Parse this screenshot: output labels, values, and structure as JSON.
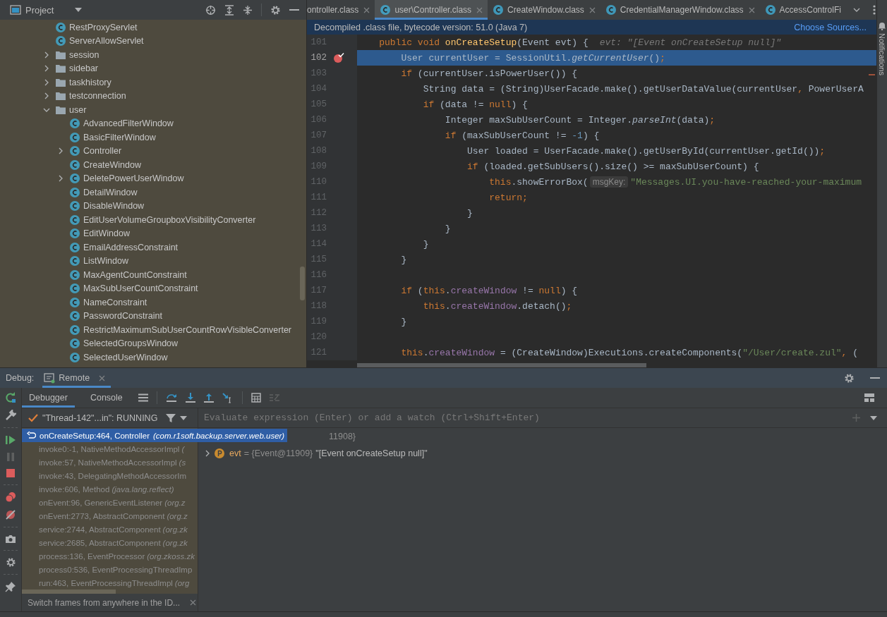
{
  "project": {
    "title": "Project",
    "tree": [
      {
        "label": "RestProxyServlet",
        "kind": "class"
      },
      {
        "label": "ServerAllowServlet",
        "kind": "class"
      },
      {
        "label": "session",
        "kind": "folder",
        "expanded": false
      },
      {
        "label": "sidebar",
        "kind": "folder",
        "expanded": false
      },
      {
        "label": "taskhistory",
        "kind": "folder",
        "expanded": false
      },
      {
        "label": "testconnection",
        "kind": "folder",
        "expanded": false
      },
      {
        "label": "user",
        "kind": "folder",
        "expanded": true,
        "children": [
          {
            "label": "AdvancedFilterWindow",
            "kind": "class"
          },
          {
            "label": "BasicFilterWindow",
            "kind": "class"
          },
          {
            "label": "Controller",
            "kind": "class",
            "expanded": false
          },
          {
            "label": "CreateWindow",
            "kind": "class"
          },
          {
            "label": "DeletePowerUserWindow",
            "kind": "class",
            "expanded": false
          },
          {
            "label": "DetailWindow",
            "kind": "class"
          },
          {
            "label": "DisableWindow",
            "kind": "class"
          },
          {
            "label": "EditUserVolumeGroupboxVisibilityConverter",
            "kind": "class"
          },
          {
            "label": "EditWindow",
            "kind": "class"
          },
          {
            "label": "EmailAddressConstraint",
            "kind": "class"
          },
          {
            "label": "ListWindow",
            "kind": "class"
          },
          {
            "label": "MaxAgentCountConstraint",
            "kind": "class"
          },
          {
            "label": "MaxSubUserCountConstraint",
            "kind": "class"
          },
          {
            "label": "NameConstraint",
            "kind": "class"
          },
          {
            "label": "PasswordConstraint",
            "kind": "class"
          },
          {
            "label": "RestrictMaximumSubUserCountRowVisibleConverter",
            "kind": "class"
          },
          {
            "label": "SelectedGroupsWindow",
            "kind": "class"
          },
          {
            "label": "SelectedUserWindow",
            "kind": "class"
          }
        ]
      }
    ]
  },
  "editor_tabs": [
    {
      "label": "ontroller.class",
      "selected": false,
      "file_icon": false,
      "closable": true
    },
    {
      "label": "user\\Controller.class",
      "selected": true,
      "file_icon": true,
      "closable": true
    },
    {
      "label": "CreateWindow.class",
      "selected": false,
      "file_icon": true,
      "closable": true
    },
    {
      "label": "CredentialManagerWindow.class",
      "selected": false,
      "file_icon": true,
      "closable": true
    },
    {
      "label": "AccessControlFi",
      "selected": false,
      "file_icon": true,
      "closable": false
    }
  ],
  "info_bar": {
    "message": "Decompiled .class file, bytecode version: 51.0 (Java 7)",
    "link": "Choose Sources..."
  },
  "code_lines": [
    {
      "number": "101",
      "current": false,
      "breakpoint": false,
      "tokens": [
        {
          "kind": "keyword",
          "text": "    public void "
        },
        {
          "kind": "method",
          "text": "onCreateSetup"
        },
        {
          "kind": "plain",
          "text": "(Event evt) {"
        },
        {
          "kind": "value-hint",
          "text": "evt: \"[Event onCreateSetup null]\""
        }
      ]
    },
    {
      "number": "102",
      "current": true,
      "breakpoint": true,
      "tokens": [
        {
          "kind": "plain",
          "text": "        User currentUser = SessionUtil."
        },
        {
          "kind": "italic",
          "text": "getCurrentUser"
        },
        {
          "kind": "plain",
          "text": "()"
        },
        {
          "kind": "keyword",
          "text": ";"
        }
      ]
    },
    {
      "number": "103",
      "current": false,
      "breakpoint": false,
      "tokens": [
        {
          "kind": "keyword",
          "text": "        if "
        },
        {
          "kind": "plain",
          "text": "(currentUser.isPowerUser()) {"
        }
      ]
    },
    {
      "number": "104",
      "current": false,
      "breakpoint": false,
      "tokens": [
        {
          "kind": "plain",
          "text": "            String data = (String)UserFacade.make().getUserDataValue(currentUser"
        },
        {
          "kind": "keyword",
          "text": ", "
        },
        {
          "kind": "plain",
          "text": "PowerUserA"
        }
      ]
    },
    {
      "number": "105",
      "current": false,
      "breakpoint": false,
      "tokens": [
        {
          "kind": "keyword",
          "text": "            if "
        },
        {
          "kind": "plain",
          "text": "(data != "
        },
        {
          "kind": "keyword",
          "text": "null"
        },
        {
          "kind": "plain",
          "text": ") {"
        }
      ]
    },
    {
      "number": "106",
      "current": false,
      "breakpoint": false,
      "tokens": [
        {
          "kind": "plain",
          "text": "                Integer maxSubUserCount = Integer."
        },
        {
          "kind": "italic",
          "text": "parseInt"
        },
        {
          "kind": "plain",
          "text": "(data)"
        },
        {
          "kind": "keyword",
          "text": ";"
        }
      ]
    },
    {
      "number": "107",
      "current": false,
      "breakpoint": false,
      "tokens": [
        {
          "kind": "keyword",
          "text": "                if "
        },
        {
          "kind": "plain",
          "text": "(maxSubUserCount != "
        },
        {
          "kind": "number",
          "text": "-1"
        },
        {
          "kind": "plain",
          "text": ") {"
        }
      ]
    },
    {
      "number": "108",
      "current": false,
      "breakpoint": false,
      "tokens": [
        {
          "kind": "plain",
          "text": "                    User loaded = UserFacade.make().getUserById(currentUser.getId())"
        },
        {
          "kind": "keyword",
          "text": ";"
        }
      ]
    },
    {
      "number": "109",
      "current": false,
      "breakpoint": false,
      "tokens": [
        {
          "kind": "keyword",
          "text": "                    if "
        },
        {
          "kind": "plain",
          "text": "(loaded.getSubUsers().size() >= maxSubUserCount) {"
        }
      ]
    },
    {
      "number": "110",
      "current": false,
      "breakpoint": false,
      "tokens": [
        {
          "kind": "keyword",
          "text": "                        this"
        },
        {
          "kind": "plain",
          "text": ".showErrorBox("
        },
        {
          "kind": "param-hint",
          "text": "msgKey:"
        },
        {
          "kind": "string",
          "text": "\"Messages.UI.you-have-reached-your-maximum"
        }
      ]
    },
    {
      "number": "111",
      "current": false,
      "breakpoint": false,
      "tokens": [
        {
          "kind": "keyword",
          "text": "                        return;"
        }
      ]
    },
    {
      "number": "112",
      "current": false,
      "breakpoint": false,
      "tokens": [
        {
          "kind": "plain",
          "text": "                    }"
        }
      ]
    },
    {
      "number": "113",
      "current": false,
      "breakpoint": false,
      "tokens": [
        {
          "kind": "plain",
          "text": "                }"
        }
      ]
    },
    {
      "number": "114",
      "current": false,
      "breakpoint": false,
      "tokens": [
        {
          "kind": "plain",
          "text": "            }"
        }
      ]
    },
    {
      "number": "115",
      "current": false,
      "breakpoint": false,
      "tokens": [
        {
          "kind": "plain",
          "text": "        }"
        }
      ]
    },
    {
      "number": "116",
      "current": false,
      "breakpoint": false
    },
    {
      "number": "117",
      "current": false,
      "breakpoint": false,
      "tokens": [
        {
          "kind": "keyword",
          "text": "        if "
        },
        {
          "kind": "plain",
          "text": "("
        },
        {
          "kind": "keyword",
          "text": "this"
        },
        {
          "kind": "plain",
          "text": "."
        },
        {
          "kind": "field",
          "text": "createWindow"
        },
        {
          "kind": "plain",
          "text": " != "
        },
        {
          "kind": "keyword",
          "text": "null"
        },
        {
          "kind": "plain",
          "text": ") {"
        }
      ]
    },
    {
      "number": "118",
      "current": false,
      "breakpoint": false,
      "tokens": [
        {
          "kind": "keyword",
          "text": "            this"
        },
        {
          "kind": "plain",
          "text": "."
        },
        {
          "kind": "field",
          "text": "createWindow"
        },
        {
          "kind": "plain",
          "text": ".detach()"
        },
        {
          "kind": "keyword",
          "text": ";"
        }
      ]
    },
    {
      "number": "119",
      "current": false,
      "breakpoint": false,
      "tokens": [
        {
          "kind": "plain",
          "text": "        }"
        }
      ]
    },
    {
      "number": "120",
      "current": false,
      "breakpoint": false
    },
    {
      "number": "121",
      "current": false,
      "breakpoint": false,
      "tokens": [
        {
          "kind": "keyword",
          "text": "        this"
        },
        {
          "kind": "plain",
          "text": "."
        },
        {
          "kind": "field",
          "text": "createWindow"
        },
        {
          "kind": "plain",
          "text": " = (CreateWindow)Executions.createComponents("
        },
        {
          "kind": "string",
          "text": "\"/User/create.zul\""
        },
        {
          "kind": "keyword",
          "text": ", "
        },
        {
          "kind": "plain",
          "text": "("
        }
      ]
    }
  ],
  "notifications_label": "Notifications",
  "debug": {
    "label": "Debug:",
    "session_tabs": [
      {
        "label": "Remote",
        "selected": true
      }
    ],
    "tabs": [
      {
        "label": "Debugger",
        "selected": true
      },
      {
        "label": "Console",
        "selected": false
      }
    ],
    "thread": {
      "label": "\"Thread-142\"...in\": RUNNING"
    },
    "frames": [
      {
        "method": "onCreateSetup:464, Controller",
        "package": "(com.r1soft.backup.server.web.user)",
        "selected": true
      },
      {
        "method": "invoke0:-1, NativeMethodAccessorImpl",
        "package": "(",
        "selected": false
      },
      {
        "method": "invoke:57, NativeMethodAccessorImpl",
        "package": "(s",
        "selected": false
      },
      {
        "method": "invoke:43, DelegatingMethodAccessorIm",
        "selected": false
      },
      {
        "method": "invoke:606, Method",
        "package": "(java.lang.reflect)",
        "selected": false
      },
      {
        "method": "onEvent:96, GenericEventListener",
        "package": "(org.z",
        "selected": false
      },
      {
        "method": "onEvent:2773, AbstractComponent",
        "package": "(org.z",
        "selected": false
      },
      {
        "method": "service:2744, AbstractComponent",
        "package": "(org.zk",
        "selected": false
      },
      {
        "method": "service:2685, AbstractComponent",
        "package": "(org.zk",
        "selected": false
      },
      {
        "method": "process:136, EventProcessor",
        "package": "(org.zkoss.zk",
        "selected": false
      },
      {
        "method": "process0:536, EventProcessingThreadImp",
        "selected": false
      },
      {
        "method": "run:463, EventProcessingThreadImpl",
        "package": "(org",
        "selected": false
      }
    ],
    "frames_hint": "Switch frames from anywhere in the ID...",
    "evaluate_placeholder": "Evaluate expression (Enter) or add a watch (Ctrl+Shift+Enter)",
    "variables": [
      {
        "kind": "hidden",
        "value": "11908}"
      },
      {
        "kind": "parameter",
        "name": "evt",
        "type": "= {Event@11909}",
        "value": "\"[Event onCreateSetup null]\""
      }
    ]
  }
}
